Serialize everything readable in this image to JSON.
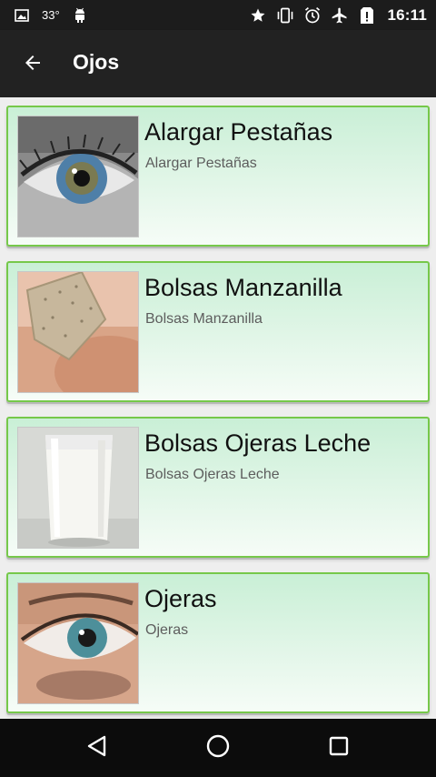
{
  "status_bar": {
    "temperature": "33°",
    "time": "16:11",
    "icons": [
      "image-icon",
      "android-icon",
      "star-icon",
      "vibrate-icon",
      "alarm-icon",
      "airplane-mode-icon",
      "no-sim-icon"
    ]
  },
  "toolbar": {
    "title": "Ojos",
    "back_icon": "arrow-back-icon"
  },
  "items": [
    {
      "title": "Alargar Pestañas",
      "subtitle": "Alargar Pestañas",
      "thumb": "eye-closeup-photo"
    },
    {
      "title": "Bolsas Manzanilla",
      "subtitle": "Bolsas Manzanilla",
      "thumb": "tea-bag-photo"
    },
    {
      "title": "Bolsas Ojeras Leche",
      "subtitle": "Bolsas Ojeras Leche",
      "thumb": "glass-of-milk-photo"
    },
    {
      "title": "Ojeras",
      "subtitle": "Ojeras",
      "thumb": "eye-dark-circles-photo"
    }
  ],
  "nav_bar": {
    "icons": [
      "back-triangle-icon",
      "home-circle-icon",
      "recents-square-icon"
    ]
  },
  "colors": {
    "status_bar": "#1c1c1c",
    "toolbar": "#222222",
    "card_border": "#76c84a",
    "card_bg_top": "#c9efd6",
    "nav_bar": "#0c0c0c"
  }
}
